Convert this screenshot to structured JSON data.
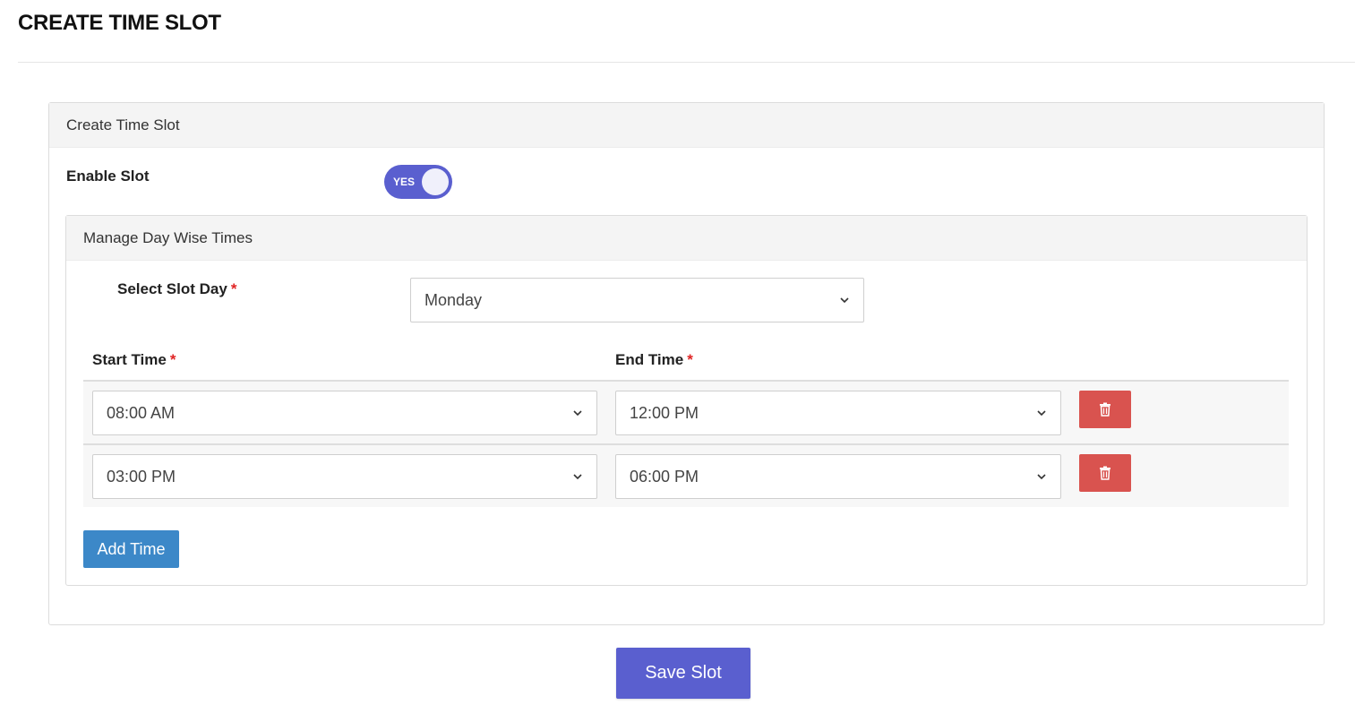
{
  "page": {
    "title": "CREATE TIME SLOT"
  },
  "card": {
    "header": "Create Time Slot",
    "enable_label": "Enable Slot",
    "toggle_text": "YES",
    "toggle_color": "#5a5fcf"
  },
  "day_card": {
    "header": "Manage Day Wise Times",
    "slot_day_label": "Select Slot Day",
    "slot_day_value": "Monday",
    "start_label": "Start Time",
    "end_label": "End Time",
    "required_mark": "*",
    "rows": [
      {
        "start": "08:00 AM",
        "end": "12:00 PM"
      },
      {
        "start": "03:00 PM",
        "end": "06:00 PM"
      }
    ],
    "add_label": "Add Time",
    "delete_icon": "trash-icon",
    "delete_color": "#d9534f",
    "add_color": "#3c88c8"
  },
  "actions": {
    "save_label": "Save Slot"
  }
}
